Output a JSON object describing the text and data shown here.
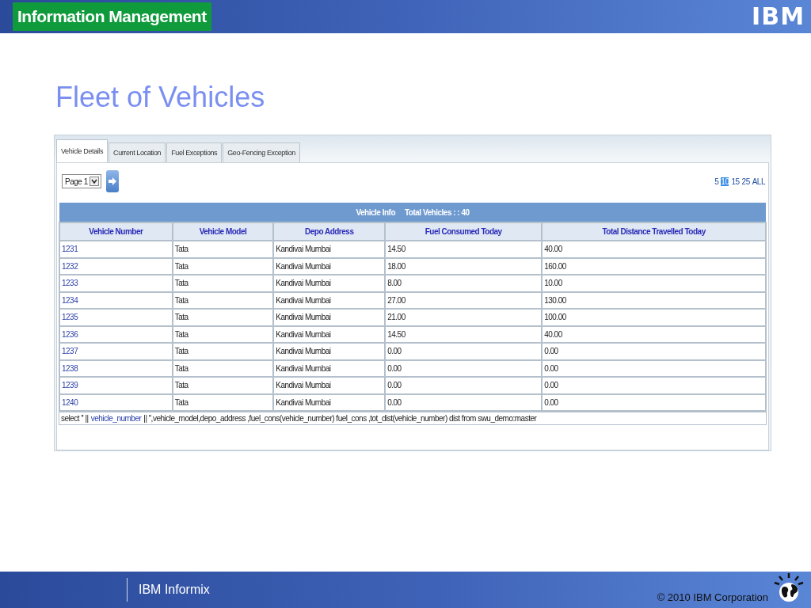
{
  "header": {
    "title": "Information Management",
    "logo": "IBM"
  },
  "slide_title": "Fleet of Vehicles",
  "app": {
    "tabs": [
      {
        "label": "Vehicle Details",
        "selected": true
      },
      {
        "label": "Current Location",
        "selected": false
      },
      {
        "label": "Fuel Exceptions",
        "selected": false
      },
      {
        "label": "Geo-Fencing Exception",
        "selected": false
      }
    ],
    "page_select": {
      "value": "Page 1"
    },
    "page_sizes": [
      {
        "label": "5",
        "selected": false
      },
      {
        "label": "10",
        "selected": true
      },
      {
        "label": "15",
        "selected": false
      },
      {
        "label": "25",
        "selected": false
      },
      {
        "label": "ALL",
        "selected": false
      }
    ],
    "table": {
      "caption": "Vehicle Info",
      "total": "Total Vehicles : : 40",
      "columns": [
        "Vehicle Number",
        "Vehicle Model",
        "Depo Address",
        "Fuel Consumed Today",
        "Total Distance Travelled Today"
      ],
      "rows": [
        [
          "1231",
          "Tata",
          "Kandivai Mumbai",
          "14.50",
          "40.00"
        ],
        [
          "1232",
          "Tata",
          "Kandivai Mumbai",
          "18.00",
          "160.00"
        ],
        [
          "1233",
          "Tata",
          "Kandivai Mumbai",
          "8.00",
          "10.00"
        ],
        [
          "1234",
          "Tata",
          "Kandivai Mumbai",
          "27.00",
          "130.00"
        ],
        [
          "1235",
          "Tata",
          "Kandivai Mumbai",
          "21.00",
          "100.00"
        ],
        [
          "1236",
          "Tata",
          "Kandivai Mumbai",
          "14.50",
          "40.00"
        ],
        [
          "1237",
          "Tata",
          "Kandivai Mumbai",
          "0.00",
          "0.00"
        ],
        [
          "1238",
          "Tata",
          "Kandivai Mumbai",
          "0.00",
          "0.00"
        ],
        [
          "1239",
          "Tata",
          "Kandivai Mumbai",
          "0.00",
          "0.00"
        ],
        [
          "1240",
          "Tata",
          "Kandivai Mumbai",
          "0.00",
          "0.00"
        ]
      ]
    },
    "sql": {
      "before": "select '' ||",
      "link": "vehicle_number",
      "after": "|| '',vehicle_model,depo_address ,fuel_cons(vehicle_number) fuel_cons ,tot_dist(vehicle_number) dist from swu_demo:master"
    }
  },
  "footer": {
    "product": "IBM Informix",
    "copyright": "© 2010 IBM Corporation"
  }
}
